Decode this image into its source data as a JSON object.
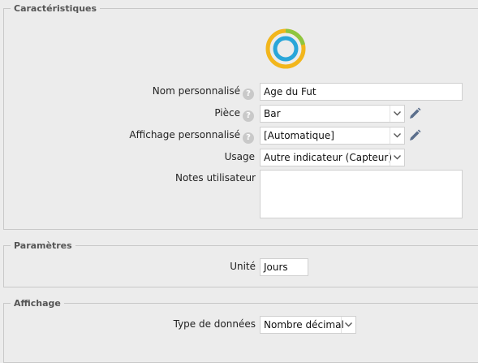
{
  "sections": {
    "caracteristiques": {
      "title": "Caractéristiques",
      "icon": "ring-gauge-icon",
      "fields": {
        "nom": {
          "label": "Nom personnalisé",
          "value": "Age du Fut"
        },
        "piece": {
          "label": "Pièce",
          "value": "Bar"
        },
        "affichage": {
          "label": "Affichage personnalisé",
          "value": "[Automatique]"
        },
        "usage": {
          "label": "Usage",
          "value": "Autre indicateur (Capteur)"
        },
        "notes": {
          "label": "Notes utilisateur",
          "value": ""
        }
      }
    },
    "parametres": {
      "title": "Paramètres",
      "fields": {
        "unite": {
          "label": "Unité",
          "value": "Jours"
        }
      }
    },
    "affichage": {
      "title": "Affichage",
      "fields": {
        "type": {
          "label": "Type de données",
          "value": "Nombre décimal"
        }
      }
    }
  },
  "help_glyph": "?",
  "colors": {
    "ring_outer": "#f2b61c",
    "ring_outer_secondary": "#8dc63f",
    "ring_inner": "#2aa6d9",
    "pencil": "#5b6f8c"
  }
}
